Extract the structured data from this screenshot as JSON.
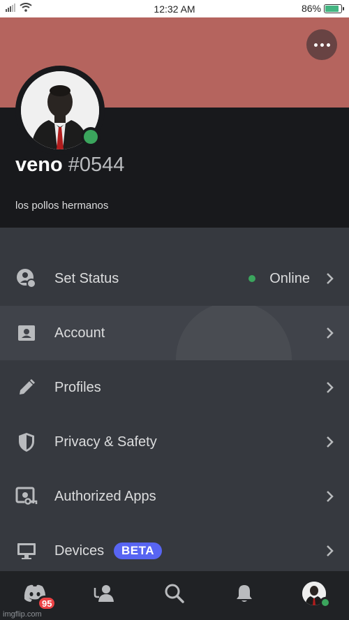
{
  "statusbar": {
    "time": "12:32 AM",
    "battery": "86%",
    "battery_level": 0.86
  },
  "colors": {
    "banner": "#b5645e",
    "accent": "#5865f2",
    "online": "#3ba55d",
    "badge": "#ed4245"
  },
  "profile": {
    "username": "veno",
    "tag": "#0544",
    "bio": "los pollos hermanos",
    "presence": "online"
  },
  "menu": {
    "items": [
      {
        "label": "Set Status",
        "icon": "status-face-icon",
        "value": "Online"
      },
      {
        "label": "Account",
        "icon": "account-card-icon"
      },
      {
        "label": "Profiles",
        "icon": "pencil-icon"
      },
      {
        "label": "Privacy & Safety",
        "icon": "shield-icon"
      },
      {
        "label": "Authorized Apps",
        "icon": "apps-key-icon"
      },
      {
        "label": "Devices",
        "icon": "monitor-icon",
        "badge": "BETA"
      }
    ]
  },
  "nav": {
    "home_badge": "95",
    "items": [
      "discord-home-icon",
      "friends-icon",
      "search-icon",
      "bell-icon",
      "user-avatar"
    ]
  },
  "watermark": "imgflip.com"
}
